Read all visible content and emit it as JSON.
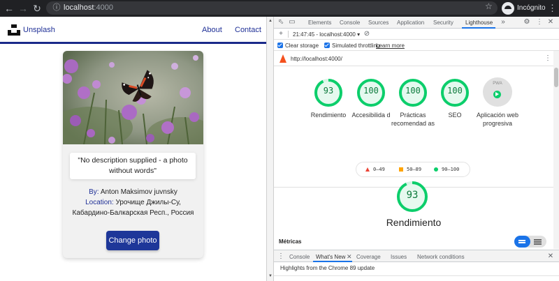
{
  "browser": {
    "url_host": "localhost",
    "url_port": ":4000",
    "profile_label": "Incógnito"
  },
  "site": {
    "brand": "Unsplash",
    "nav": [
      "About",
      "Contact"
    ],
    "quote": "\"No description supplied - a photo without words\"",
    "by_label": "By:",
    "author": "Anton Maksimov juvnsky",
    "location_label": "Location:",
    "location_line1": "Урочище Джилы-Су,",
    "location_line2": "Кабардино-Балкарская Респ., Россия",
    "button": "Change photo"
  },
  "devtools": {
    "tabs": [
      "Elements",
      "Console",
      "Sources",
      "Application",
      "Security",
      "Lighthouse"
    ],
    "active_tab": "Lighthouse",
    "report_time": "21:47:45 - localhost:4000",
    "clear_storage": "Clear storage",
    "throttling": "Simulated throttling",
    "learn_more": "Learn more",
    "audited_url": "http://localhost:4000/",
    "scores": [
      {
        "value": "93",
        "label": "Rendimiento"
      },
      {
        "value": "100",
        "label": "Accesibilida d"
      },
      {
        "value": "100",
        "label": "Prácticas recomendad as"
      },
      {
        "value": "100",
        "label": "SEO"
      }
    ],
    "pwa_label": "Aplicación web progresiva",
    "pwa_badge": "PWA",
    "legend": [
      "0–49",
      "50–89",
      "90–100"
    ],
    "main_score": "93",
    "main_label": "Rendimiento",
    "metrics_label": "Métricas",
    "drawer_tabs": [
      "Console",
      "What's New",
      "Coverage",
      "Issues",
      "Network conditions"
    ],
    "drawer_text": "Highlights from the Chrome 89 update"
  },
  "colors": {
    "accent": "#1e2f96",
    "pass": "#0cce6b",
    "average": "#ffa400",
    "fail": "#eb4335"
  }
}
